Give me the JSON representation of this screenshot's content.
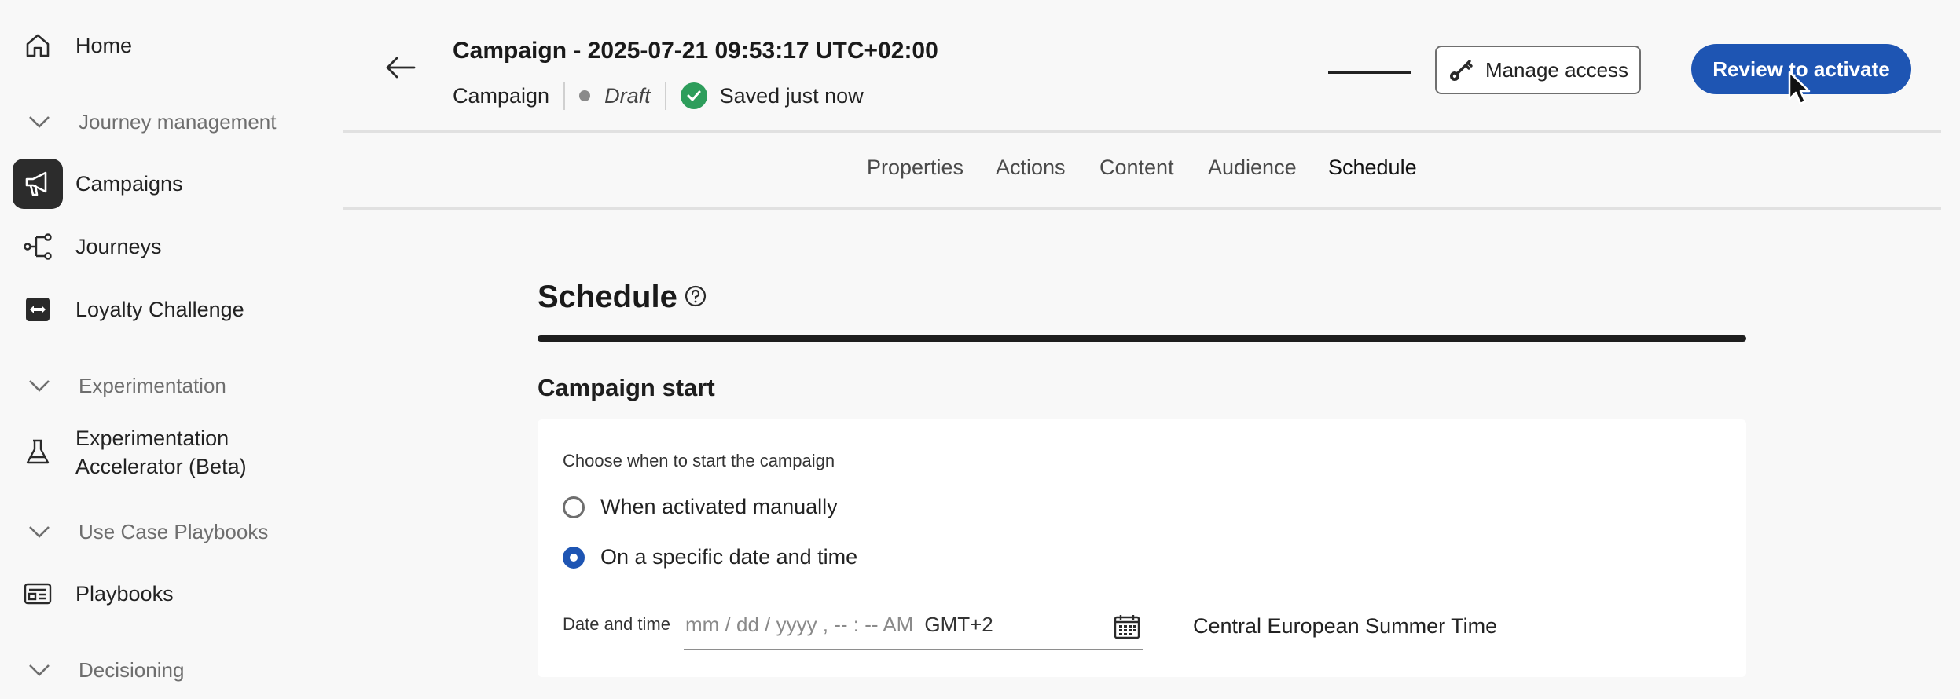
{
  "sidebar": {
    "home": "Home",
    "journey_management": "Journey management",
    "campaigns": "Campaigns",
    "journeys": "Journeys",
    "loyalty_challenge": "Loyalty Challenge",
    "experimentation": "Experimentation",
    "experimentation_accelerator_line1": "Experimentation",
    "experimentation_accelerator_line2": "Accelerator (Beta)",
    "use_case_playbooks": "Use Case Playbooks",
    "playbooks": "Playbooks",
    "decisioning": "Decisioning"
  },
  "header": {
    "title": "Campaign - 2025-07-21 09:53:17 UTC+02:00",
    "type": "Campaign",
    "status": "Draft",
    "saved": "Saved just now",
    "manage_access": "Manage access",
    "review_to_activate": "Review to activate"
  },
  "tabs": [
    "Properties",
    "Actions",
    "Content",
    "Audience",
    "Schedule"
  ],
  "main": {
    "page_title": "Schedule",
    "section_title": "Campaign start",
    "choose_label": "Choose when to start the campaign",
    "option_manual": "When activated manually",
    "option_specific": "On a specific date and time",
    "date_time_label": "Date and time",
    "date_placeholder": "mm / dd / yyyy ,  -- : --  AM",
    "timezone_offset": "GMT+2",
    "timezone_name": "Central European Summer Time"
  },
  "colors": {
    "accent": "#1e55b3",
    "success": "#2d9d5b"
  }
}
